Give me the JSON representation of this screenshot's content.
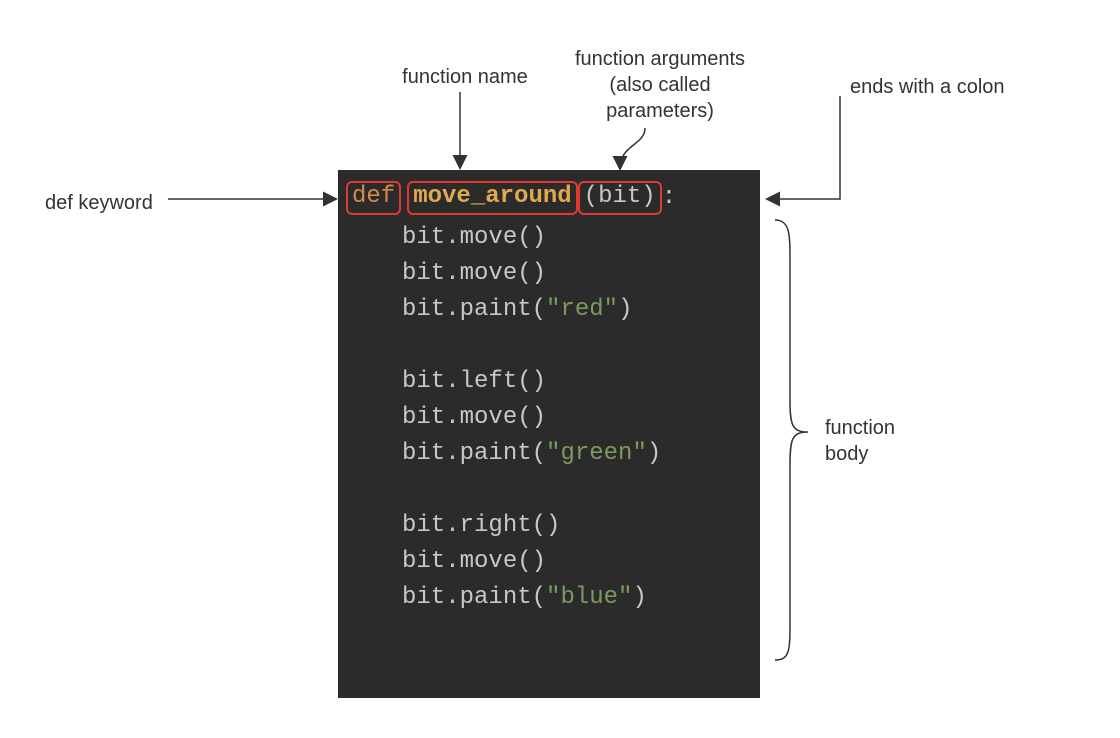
{
  "labels": {
    "def_keyword": "def keyword",
    "function_name": "function name",
    "arguments_line1": "function arguments",
    "arguments_line2": "(also called",
    "arguments_line3": "parameters)",
    "ends_colon": "ends with a colon",
    "function_body_line1": "function",
    "function_body_line2": "body"
  },
  "code": {
    "def_kw": "def",
    "fn_name": "move_around",
    "arg_open": "(",
    "arg_name": "bit",
    "arg_close": ")",
    "colon": ":",
    "lines": [
      {
        "kind": "call",
        "obj": "bit",
        "method": "move",
        "args": ""
      },
      {
        "kind": "call",
        "obj": "bit",
        "method": "move",
        "args": ""
      },
      {
        "kind": "call",
        "obj": "bit",
        "method": "paint",
        "args": "\"red\""
      },
      {
        "kind": "blank"
      },
      {
        "kind": "call",
        "obj": "bit",
        "method": "left",
        "args": ""
      },
      {
        "kind": "call",
        "obj": "bit",
        "method": "move",
        "args": ""
      },
      {
        "kind": "call",
        "obj": "bit",
        "method": "paint",
        "args": "\"green\""
      },
      {
        "kind": "blank"
      },
      {
        "kind": "call",
        "obj": "bit",
        "method": "right",
        "args": ""
      },
      {
        "kind": "call",
        "obj": "bit",
        "method": "move",
        "args": ""
      },
      {
        "kind": "call",
        "obj": "bit",
        "method": "paint",
        "args": "\"blue\""
      }
    ]
  }
}
